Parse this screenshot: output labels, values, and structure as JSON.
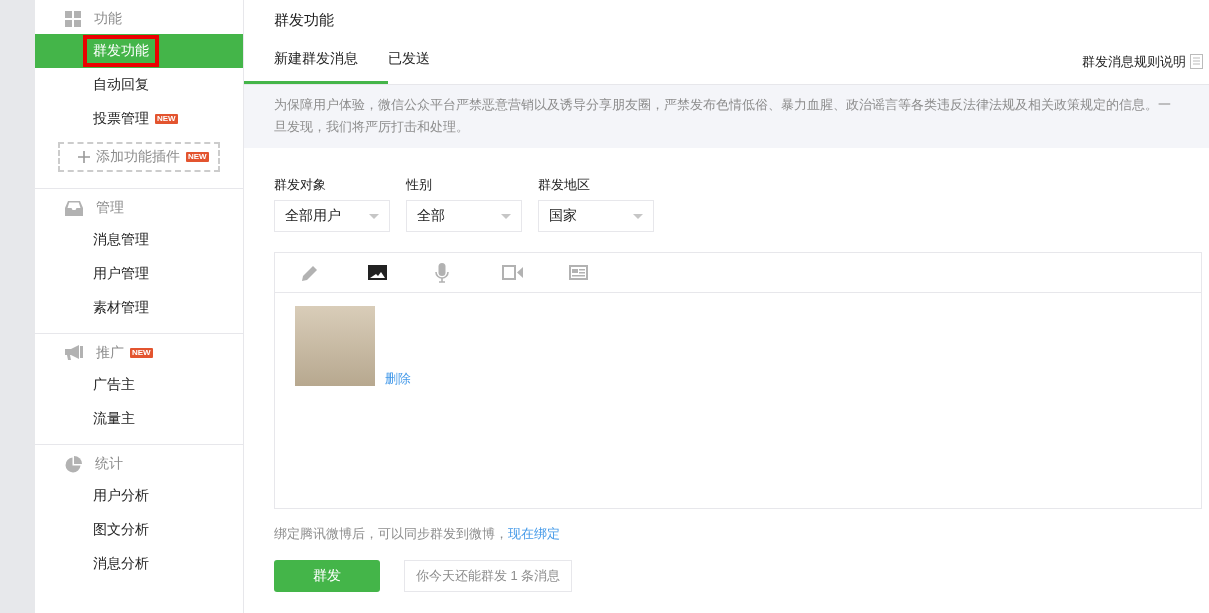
{
  "sidebar": {
    "sections": [
      {
        "kind": "grid",
        "title": "功能",
        "items": [
          {
            "label": "群发功能",
            "selected": true,
            "highlighted": true
          },
          {
            "label": "自动回复",
            "selected": false,
            "highlighted": false
          },
          {
            "label": "投票管理",
            "selected": false,
            "highlighted": false,
            "badge": "NEW"
          }
        ],
        "add_button": {
          "label": "添加功能插件",
          "badge": "NEW"
        }
      },
      {
        "kind": "inbox",
        "title": "管理",
        "items": [
          {
            "label": "消息管理",
            "selected": false,
            "highlighted": false
          },
          {
            "label": "用户管理",
            "selected": false,
            "highlighted": false
          },
          {
            "label": "素材管理",
            "selected": false,
            "highlighted": false
          }
        ]
      },
      {
        "kind": "megaphone",
        "title": "推广",
        "badge": "NEW",
        "items": [
          {
            "label": "广告主",
            "selected": false,
            "highlighted": false
          },
          {
            "label": "流量主",
            "selected": false,
            "highlighted": false
          }
        ]
      },
      {
        "kind": "pie",
        "title": "统计",
        "items": [
          {
            "label": "用户分析",
            "selected": false,
            "highlighted": false
          },
          {
            "label": "图文分析",
            "selected": false,
            "highlighted": false
          },
          {
            "label": "消息分析",
            "selected": false,
            "highlighted": false
          }
        ]
      }
    ]
  },
  "main": {
    "title": "群发功能",
    "tabs": [
      {
        "label": "新建群发消息",
        "selected": true
      },
      {
        "label": "已发送",
        "selected": false
      }
    ],
    "rules_link": "群发消息规则说明",
    "notice": "为保障用户体验，微信公众平台严禁恶意营销以及诱导分享朋友圈，严禁发布色情低俗、暴力血腥、政治谣言等各类违反法律法规及相关政策规定的信息。一旦发现，我们将严厉打击和处理。",
    "filters": [
      {
        "label": "群发对象",
        "value": "全部用户"
      },
      {
        "label": "性别",
        "value": "全部"
      },
      {
        "label": "群发地区",
        "value": "国家"
      }
    ],
    "editor": {
      "tools": [
        {
          "kind": "text",
          "selected": false
        },
        {
          "kind": "image",
          "selected": true
        },
        {
          "kind": "voice",
          "selected": false
        },
        {
          "kind": "video",
          "selected": false
        },
        {
          "kind": "article",
          "selected": false
        }
      ],
      "delete_link": "删除"
    },
    "bind_text": "绑定腾讯微博后，可以同步群发到微博，",
    "bind_link": "现在绑定",
    "send_button": "群发",
    "quota_tip": "你今天还能群发 1 条消息"
  }
}
